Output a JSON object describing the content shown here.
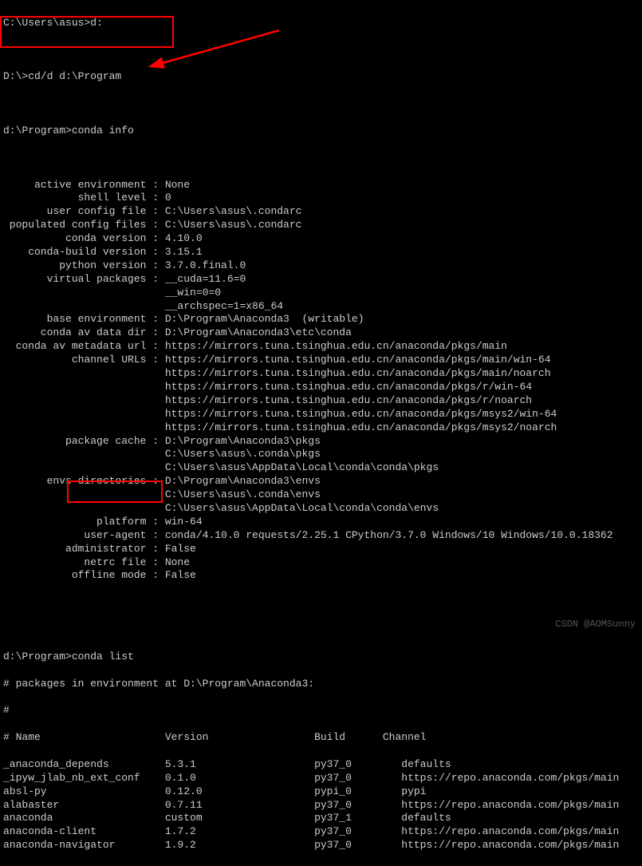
{
  "prompts": {
    "p1": "C:\\Users\\asus>d:",
    "p2": "D:\\>cd/d d:\\Program",
    "p3": "d:\\Program>conda info"
  },
  "info_rows": [
    {
      "k": "     active environment",
      "v": "None"
    },
    {
      "k": "            shell level",
      "v": "0"
    },
    {
      "k": "       user config file",
      "v": "C:\\Users\\asus\\.condarc"
    },
    {
      "k": " populated config files",
      "v": "C:\\Users\\asus\\.condarc"
    },
    {
      "k": "          conda version",
      "v": "4.10.0"
    },
    {
      "k": "    conda-build version",
      "v": "3.15.1"
    },
    {
      "k": "         python version",
      "v": "3.7.0.final.0"
    },
    {
      "k": "       virtual packages",
      "v": "__cuda=11.6=0"
    },
    {
      "k": "",
      "v": "__win=0=0"
    },
    {
      "k": "",
      "v": "__archspec=1=x86_64"
    },
    {
      "k": "       base environment",
      "v": "D:\\Program\\Anaconda3  (writable)"
    },
    {
      "k": "      conda av data dir",
      "v": "D:\\Program\\Anaconda3\\etc\\conda"
    },
    {
      "k": "  conda av metadata url",
      "v": "https://mirrors.tuna.tsinghua.edu.cn/anaconda/pkgs/main"
    },
    {
      "k": "           channel URLs",
      "v": "https://mirrors.tuna.tsinghua.edu.cn/anaconda/pkgs/main/win-64"
    },
    {
      "k": "",
      "v": "https://mirrors.tuna.tsinghua.edu.cn/anaconda/pkgs/main/noarch"
    },
    {
      "k": "",
      "v": "https://mirrors.tuna.tsinghua.edu.cn/anaconda/pkgs/r/win-64"
    },
    {
      "k": "",
      "v": "https://mirrors.tuna.tsinghua.edu.cn/anaconda/pkgs/r/noarch"
    },
    {
      "k": "",
      "v": "https://mirrors.tuna.tsinghua.edu.cn/anaconda/pkgs/msys2/win-64"
    },
    {
      "k": "",
      "v": "https://mirrors.tuna.tsinghua.edu.cn/anaconda/pkgs/msys2/noarch"
    },
    {
      "k": "          package cache",
      "v": "D:\\Program\\Anaconda3\\pkgs"
    },
    {
      "k": "",
      "v": "C:\\Users\\asus\\.conda\\pkgs"
    },
    {
      "k": "",
      "v": "C:\\Users\\asus\\AppData\\Local\\conda\\conda\\pkgs"
    },
    {
      "k": "       envs directories",
      "v": "D:\\Program\\Anaconda3\\envs"
    },
    {
      "k": "",
      "v": "C:\\Users\\asus\\.conda\\envs"
    },
    {
      "k": "",
      "v": "C:\\Users\\asus\\AppData\\Local\\conda\\conda\\envs"
    },
    {
      "k": "               platform",
      "v": "win-64"
    },
    {
      "k": "             user-agent",
      "v": "conda/4.10.0 requests/2.25.1 CPython/3.7.0 Windows/10 Windows/10.0.18362"
    },
    {
      "k": "          administrator",
      "v": "False"
    },
    {
      "k": "             netrc file",
      "v": "None"
    },
    {
      "k": "           offline mode",
      "v": "False"
    }
  ],
  "list_prompt": "d:\\Program>conda list",
  "list_header1": "# packages in environment at D:\\Program\\Anaconda3:",
  "list_header2": "#",
  "list_cols": {
    "name": "# Name",
    "ver": "Version",
    "build": "Build",
    "chan": "Channel"
  },
  "packages": [
    {
      "name": "_anaconda_depends",
      "ver": "5.3.1",
      "build": "py37_0",
      "chan": "defaults"
    },
    {
      "name": "_ipyw_jlab_nb_ext_conf",
      "ver": "0.1.0",
      "build": "py37_0",
      "chan": "https://repo.anaconda.com/pkgs/main"
    },
    {
      "name": "absl-py",
      "ver": "0.12.0",
      "build": "pypi_0",
      "chan": "pypi"
    },
    {
      "name": "alabaster",
      "ver": "0.7.11",
      "build": "py37_0",
      "chan": "https://repo.anaconda.com/pkgs/main"
    },
    {
      "name": "anaconda",
      "ver": "custom",
      "build": "py37_1",
      "chan": "defaults"
    },
    {
      "name": "anaconda-client",
      "ver": "1.7.2",
      "build": "py37_0",
      "chan": "https://repo.anaconda.com/pkgs/main"
    },
    {
      "name": "anaconda-navigator",
      "ver": "1.9.2",
      "build": "py37_0",
      "chan": "https://repo.anaconda.com/pkgs/main"
    }
  ],
  "watermark": "CSDN @AOMSunny"
}
